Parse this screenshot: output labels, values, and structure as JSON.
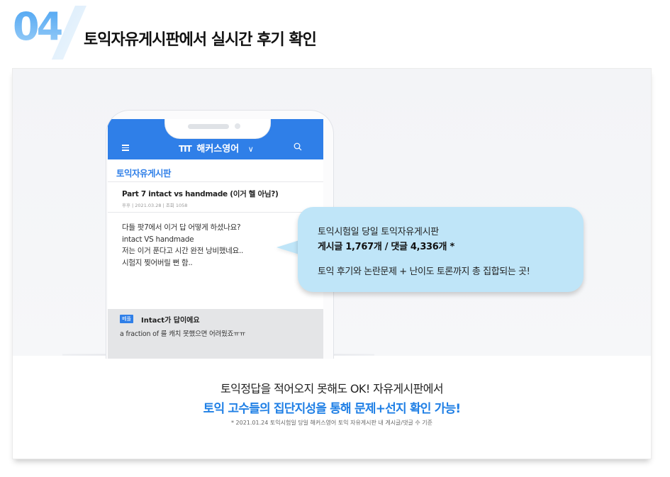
{
  "section": {
    "number": "04",
    "title": "토익자유게시판에서 실시간 후기 확인"
  },
  "colors": {
    "accent_blue": "#2f7fe8",
    "badge_blue": "#58aef3",
    "bubble_bg": "#bfe5f8",
    "highlight_text": "#1f7fe5"
  },
  "phone": {
    "app_bar": {
      "menu_icon": "hamburger-menu-icon",
      "logo_mark": "TIT",
      "logo_text": "해커스영어",
      "dropdown_icon": "chevron-down-icon",
      "search_icon": "search-icon"
    },
    "board_title": "토익자유게시판",
    "post": {
      "title": "Part 7 intact vs handmade (이거 헬 아님?)",
      "meta": "후후 | 2021.03.28 | 조회 1058",
      "body": [
        "다들 팟7에서 이거 답 어떻게 하셨나요?",
        "intact VS handmade",
        "저는 이거 푼다고 시간 완전 낭비했네요..",
        "시험지 찢어버릴 뻔 함.."
      ]
    },
    "comment": {
      "badge": "베플",
      "title": "Intact가 답이에요",
      "body": "a fraction of 를 캐치 못했으면 어려웠죠ㅠㅠ"
    }
  },
  "bubble": {
    "line1": "토익시험일 당일 토익자유게시판",
    "line2": "게시글 1,767개 / 댓글 4,336개 *",
    "line3": "토익 후기와 논란문제 + 난이도 토론까지 총 집합되는 곳!"
  },
  "bottom": {
    "line1": "토익정답을 적어오지 못해도 OK! 자유게시판에서",
    "line2": "토익 고수들의 집단지성을 통해 문제+선지 확인 가능!",
    "footnote": "* 2021.01.24 토익시험일 당일 해커스영어 토익 자유게시판 내 게시글/댓글 수 기준"
  }
}
